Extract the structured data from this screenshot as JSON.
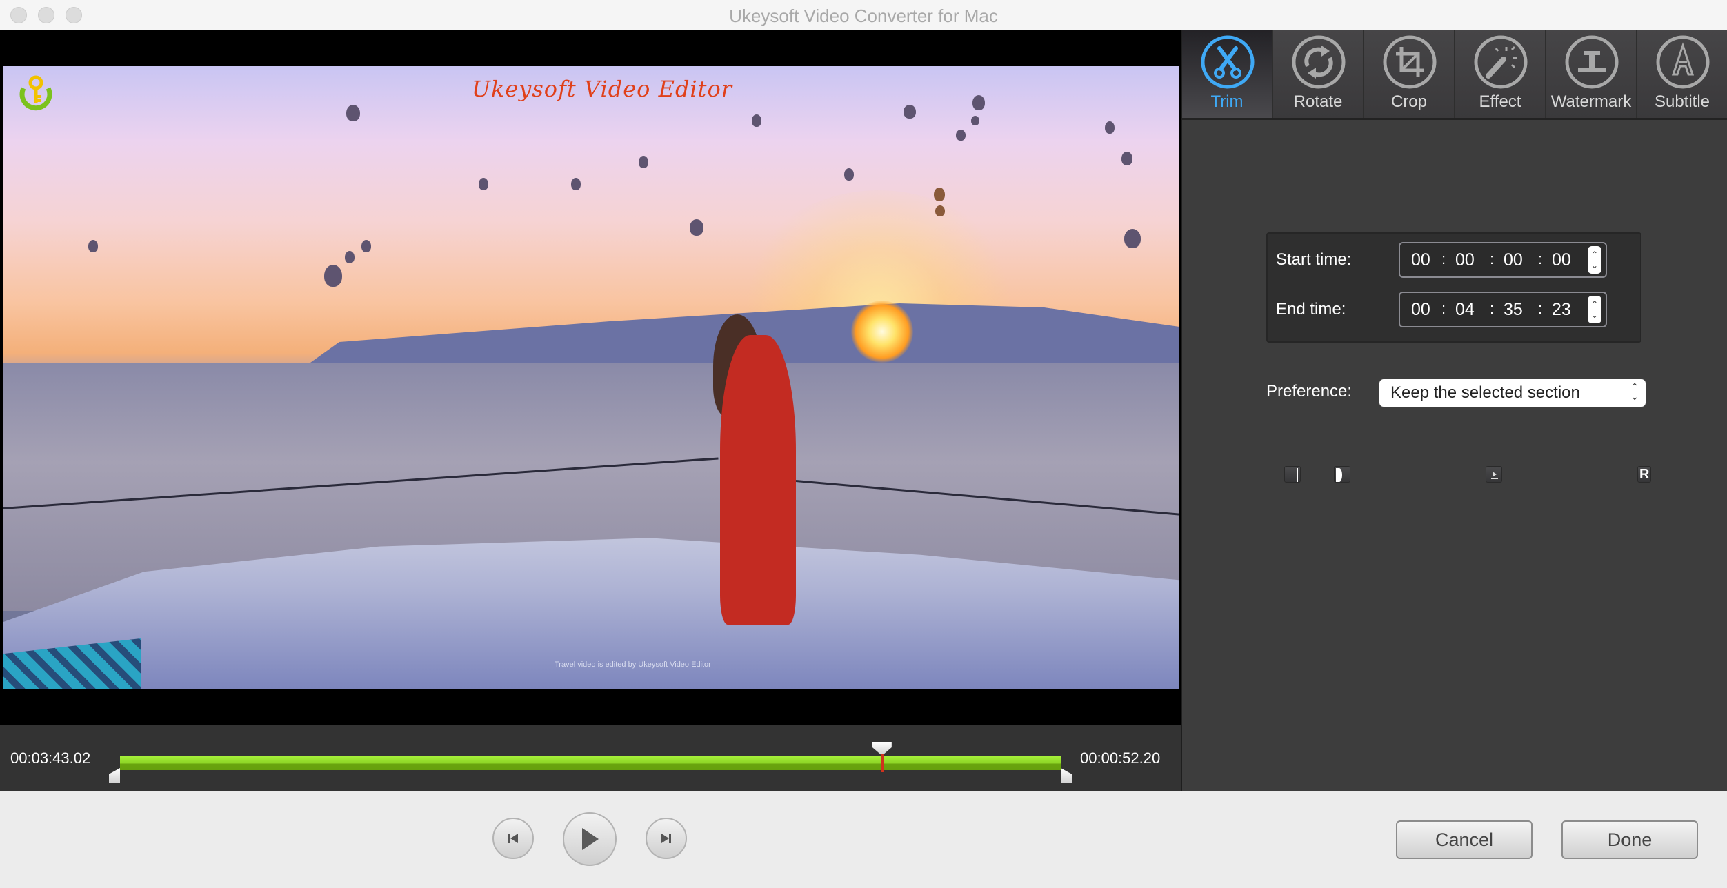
{
  "window": {
    "title": "Ukeysoft Video Converter for Mac",
    "traffic_lights": [
      "close",
      "minimize",
      "zoom"
    ]
  },
  "video": {
    "watermark_text": "Ukeysoft Video Editor",
    "caption_text": "Travel video is edited by Ukeysoft Video Editor",
    "logo_icon": "key-icon"
  },
  "timeline": {
    "current_time": "00:03:43.02",
    "remaining_time": "00:00:52.20",
    "playhead_fraction": 0.81,
    "selection_start_fraction": 0.0,
    "selection_end_fraction": 1.0,
    "track_color": "#8cd425",
    "playhead_color": "#d0321e"
  },
  "tabs": [
    {
      "label": "Trim",
      "icon": "scissors-icon",
      "active": true
    },
    {
      "label": "Rotate",
      "icon": "rotate-icon",
      "active": false
    },
    {
      "label": "Crop",
      "icon": "crop-icon",
      "active": false
    },
    {
      "label": "Effect",
      "icon": "magic-wand-icon",
      "active": false
    },
    {
      "label": "Watermark",
      "icon": "text-cursor-icon",
      "active": false
    },
    {
      "label": "Subtitle",
      "icon": "letter-a-icon",
      "active": false
    }
  ],
  "trim": {
    "start_label": "Start time:",
    "start": {
      "h": "00",
      "m": "00",
      "s": "00",
      "f": "00"
    },
    "end_label": "End time:",
    "end": {
      "h": "00",
      "m": "04",
      "s": "35",
      "f": "23"
    },
    "preference_label": "Preference:",
    "preference_value": "Keep the selected section",
    "mini_buttons": [
      {
        "name": "set-start-button",
        "glyph": "|"
      },
      {
        "name": "set-end-button",
        "glyph": "]"
      },
      {
        "name": "preview-segment-button",
        "glyph": "▶"
      },
      {
        "name": "reset-button",
        "glyph": "R"
      }
    ]
  },
  "controls": {
    "prev_icon": "skip-back-icon",
    "play_icon": "play-icon",
    "next_icon": "skip-forward-icon",
    "cancel_label": "Cancel",
    "done_label": "Done"
  },
  "colors": {
    "accent": "#3fa9f5",
    "panel_bg": "#3d3d3d",
    "timeline_bg": "#333333"
  }
}
